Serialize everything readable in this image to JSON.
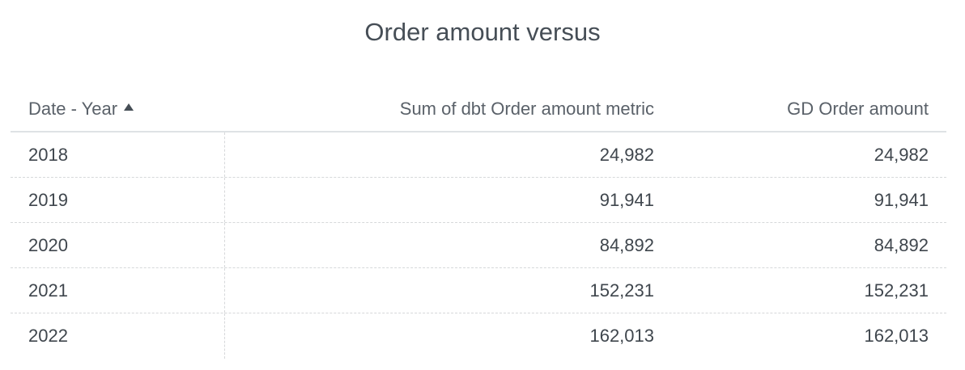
{
  "chart_data": {
    "type": "table",
    "title": "Order amount versus",
    "columns": [
      "Date - Year",
      "Sum of dbt Order amount metric",
      "GD Order amount"
    ],
    "sort": {
      "column": "Date - Year",
      "direction": "ascending",
      "icon": "sort-ascending-icon"
    },
    "rows": [
      [
        "2018",
        "24,982",
        "24,982"
      ],
      [
        "2019",
        "91,941",
        "91,941"
      ],
      [
        "2020",
        "84,892",
        "84,892"
      ],
      [
        "2021",
        "152,231",
        "152,231"
      ],
      [
        "2022",
        "162,013",
        "162,013"
      ]
    ]
  }
}
